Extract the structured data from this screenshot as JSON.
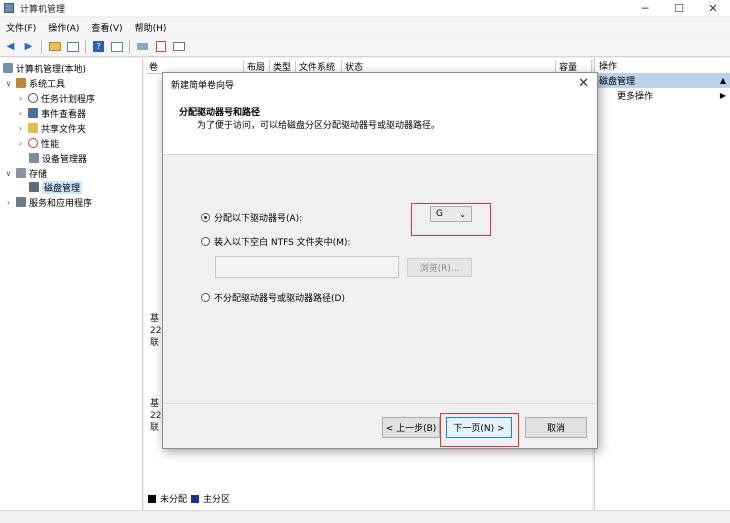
{
  "window": {
    "title": "计算机管理",
    "min": "─",
    "max": "☐",
    "close": "✕"
  },
  "menu": {
    "file": "文件(F)",
    "action": "操作(A)",
    "view": "查看(V)",
    "help": "帮助(H)"
  },
  "tree": {
    "root": "计算机管理(本地)",
    "system_tools": "系统工具",
    "task_scheduler": "任务计划程序",
    "event_viewer": "事件查看器",
    "shared_folders": "共享文件夹",
    "performance": "性能",
    "device_manager": "设备管理器",
    "storage": "存储",
    "disk_management": "磁盘管理",
    "services_apps": "服务和应用程序"
  },
  "list": {
    "columns": [
      "卷",
      "布局",
      "类型",
      "文件系统",
      "状态",
      "容量"
    ],
    "disk_blocks": [
      {
        "line1": "基",
        "line2": "22",
        "line3": "联"
      },
      {
        "line1": "基",
        "line2": "22",
        "line3": "联"
      }
    ],
    "legend_unallocated": "未分配",
    "legend_primary": "主分区"
  },
  "actions": {
    "header": "操作",
    "selected": "磁盘管理",
    "more": "更多操作"
  },
  "dialog": {
    "title": "新建简单卷向导",
    "heading": "分配驱动器号和路径",
    "subheading": "为了便于访问，可以给磁盘分区分配驱动器号或驱动器路径。",
    "opt_assign_letter": "分配以下驱动器号(A):",
    "opt_mount_folder": "装入以下空白 NTFS 文件夹中(M):",
    "opt_no_assign": "不分配驱动器号或驱动器路径(D)",
    "drive_letter": "G",
    "browse": "浏览(R)...",
    "back": "< 上一步(B)",
    "next": "下一页(N) >",
    "cancel": "取消"
  },
  "colors": {
    "highlight_box": "#e0353a",
    "selection": "#cce8ff",
    "legend_unallocated": "#000000",
    "legend_primary": "#1c2f8f"
  }
}
